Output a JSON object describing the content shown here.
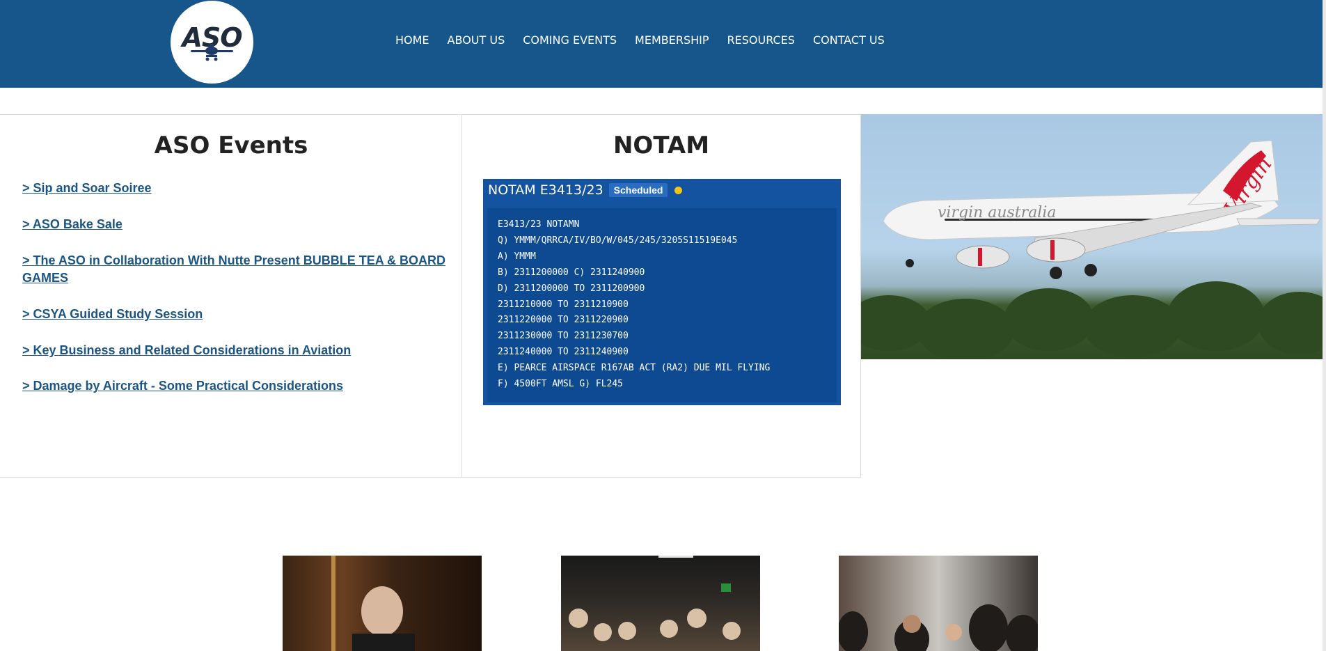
{
  "header": {
    "logo_text": "ASO",
    "nav": [
      "HOME",
      "ABOUT US",
      "COMING EVENTS",
      "MEMBERSHIP",
      "RESOURCES",
      "CONTACT US"
    ]
  },
  "events": {
    "title": "ASO Events",
    "links": [
      "> Sip and Soar Soiree",
      "> ASO Bake Sale",
      "> The ASO in Collaboration With Nutte Present BUBBLE TEA & BOARD GAMES",
      "> CSYA Guided Study Session",
      "> Key Business and Related Considerations in Aviation",
      "> Damage by Aircraft - Some Practical Considerations"
    ]
  },
  "notam": {
    "title": "NOTAM",
    "id": "NOTAM E3413/23",
    "status": "Scheduled",
    "lines": [
      "E3413/23 NOTAMN",
      "Q) YMMM/QRRCA/IV/BO/W/045/245/3205S11519E045",
      "A) YMMM",
      "B) 2311200000 C) 2311240900",
      "D) 2311200000 TO 2311200900",
      "2311210000 TO 2311210900",
      "2311220000 TO 2311220900",
      "2311230000 TO 2311230700",
      "2311240000 TO 2311240900",
      "E) PEARCE AIRSPACE R167AB ACT (RA2) DUE MIL FLYING",
      "F) 4500FT AMSL G) FL245"
    ]
  },
  "hero": {
    "livery_text": "virgin australia",
    "tail_text": "Virgin"
  },
  "colors": {
    "header_bg": "#17568a",
    "link": "#1b5585",
    "notam_box": "#1453a0",
    "status_dot": "#f3c316"
  }
}
